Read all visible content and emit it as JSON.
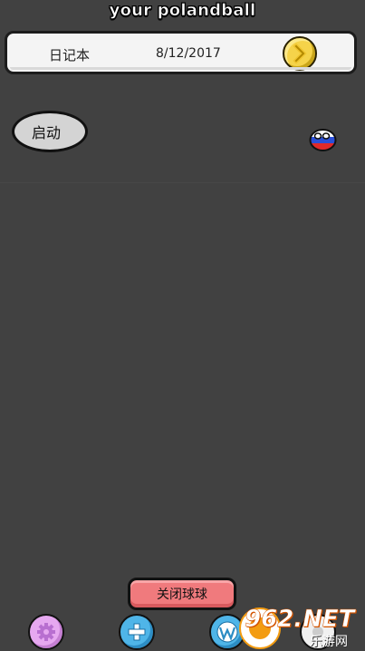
{
  "app": {
    "title": "your polandball"
  },
  "top_bar": {
    "diary_label": "日记本",
    "date": "8/12/2017",
    "next_icon": "chevron-right-icon"
  },
  "main": {
    "start_label": "启动",
    "ball": {
      "type": "polandball-russia",
      "colors": [
        "#ffffff",
        "#2b4fd8",
        "#e02a2a"
      ]
    }
  },
  "bottom": {
    "close_ball_label": "关闭球球",
    "icons": [
      "gear-icon",
      "plus-icon",
      "wordpress-icon",
      "extra-icon"
    ]
  },
  "watermark": {
    "text": "962.NET",
    "sub": "乐游网"
  },
  "colors": {
    "background": "#414141",
    "accent_yellow": "#f5d34a",
    "close_button": "#f07a7d",
    "settings_purple": "#e6a8f0",
    "add_blue": "#4fb5e8"
  }
}
